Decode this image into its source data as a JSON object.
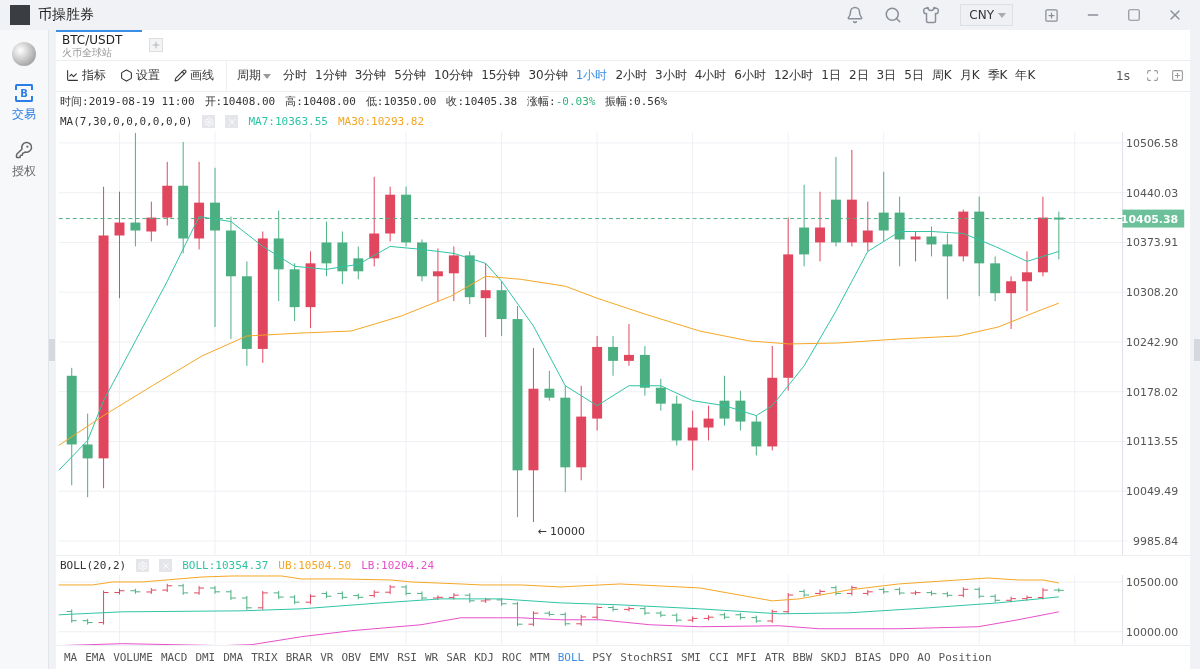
{
  "window": {
    "title": "币操胜券"
  },
  "currency": {
    "value": "CNY"
  },
  "sidebar": {
    "items": [
      {
        "kind": "trade",
        "icon_text": "B",
        "label": "交易",
        "selected": true
      },
      {
        "kind": "auth",
        "label": "授权",
        "selected": false
      }
    ]
  },
  "tabs": [
    {
      "label": "BTC/USDT",
      "sublabel": "火币全球站",
      "selected": true
    }
  ],
  "toolbar": {
    "tools": [
      {
        "kind": "indicator",
        "label": "指标"
      },
      {
        "kind": "settings",
        "label": "设置"
      },
      {
        "kind": "draw",
        "label": "画线"
      }
    ],
    "period_label": "周期",
    "periods": [
      {
        "label": "分时",
        "selected": false
      },
      {
        "label": "1分钟",
        "selected": false
      },
      {
        "label": "3分钟",
        "selected": false
      },
      {
        "label": "5分钟",
        "selected": false
      },
      {
        "label": "10分钟",
        "selected": false
      },
      {
        "label": "15分钟",
        "selected": false
      },
      {
        "label": "30分钟",
        "selected": false
      },
      {
        "label": "1小时",
        "selected": true
      },
      {
        "label": "2小时",
        "selected": false
      },
      {
        "label": "3小时",
        "selected": false
      },
      {
        "label": "4小时",
        "selected": false
      },
      {
        "label": "6小时",
        "selected": false
      },
      {
        "label": "12小时",
        "selected": false
      },
      {
        "label": "1日",
        "selected": false
      },
      {
        "label": "2日",
        "selected": false
      },
      {
        "label": "3日",
        "selected": false
      },
      {
        "label": "5日",
        "selected": false
      },
      {
        "label": "周K",
        "selected": false
      },
      {
        "label": "月K",
        "selected": false
      },
      {
        "label": "季K",
        "selected": false
      },
      {
        "label": "年K",
        "selected": false
      }
    ],
    "refresh": "1s"
  },
  "info": [
    {
      "label": "时间:",
      "value": "2019-08-19 11:00",
      "highlight": false
    },
    {
      "label": "开:",
      "value": "10408.00",
      "highlight": false
    },
    {
      "label": "高:",
      "value": "10408.00",
      "highlight": false
    },
    {
      "label": "低:",
      "value": "10350.00",
      "highlight": false
    },
    {
      "label": "收:",
      "value": "10405.38",
      "highlight": false
    },
    {
      "label": "涨幅:",
      "value": "-0.03%",
      "highlight": true
    },
    {
      "label": "振幅:",
      "value": "0.56%",
      "highlight": false
    }
  ],
  "indicator": {
    "label": "MA(7,30,0,0,0,0,0,0)",
    "values": [
      {
        "text": "MA7:10363.55",
        "color": "#2ec4a4"
      },
      {
        "text": "MA30:10293.82",
        "color": "#f5a623"
      }
    ]
  },
  "chart": {
    "price_axis": [
      "10506.58",
      "10440.03",
      "10373.91",
      "10308.20",
      "10242.90",
      "10178.02",
      "10113.55",
      "10049.49",
      "9985.84"
    ],
    "last_price": "10405.38",
    "low_marker": "← 10000"
  },
  "sub_indicator": {
    "label": "BOLL(20,2)",
    "values": [
      {
        "text": "BOLL:10354.37",
        "color": "#2ec4a4"
      },
      {
        "text": "UB:10504.50",
        "color": "#f5a623"
      },
      {
        "text": "LB:10204.24",
        "color": "#e64fc8"
      }
    ],
    "axis": [
      "10500.00",
      "10000.00"
    ]
  },
  "indicator_tabs": [
    {
      "label": "MA",
      "selected": false
    },
    {
      "label": "EMA",
      "selected": false
    },
    {
      "label": "VOLUME",
      "selected": false
    },
    {
      "label": "MACD",
      "selected": false
    },
    {
      "label": "DMI",
      "selected": false
    },
    {
      "label": "DMA",
      "selected": false
    },
    {
      "label": "TRIX",
      "selected": false
    },
    {
      "label": "BRAR",
      "selected": false
    },
    {
      "label": "VR",
      "selected": false
    },
    {
      "label": "OBV",
      "selected": false
    },
    {
      "label": "EMV",
      "selected": false
    },
    {
      "label": "RSI",
      "selected": false
    },
    {
      "label": "WR",
      "selected": false
    },
    {
      "label": "SAR",
      "selected": false
    },
    {
      "label": "KDJ",
      "selected": false
    },
    {
      "label": "ROC",
      "selected": false
    },
    {
      "label": "MTM",
      "selected": false
    },
    {
      "label": "BOLL",
      "selected": true
    },
    {
      "label": "PSY",
      "selected": false
    },
    {
      "label": "StochRSI",
      "selected": false
    },
    {
      "label": "SMI",
      "selected": false
    },
    {
      "label": "CCI",
      "selected": false
    },
    {
      "label": "MFI",
      "selected": false
    },
    {
      "label": "ATR",
      "selected": false
    },
    {
      "label": "BBW",
      "selected": false
    },
    {
      "label": "SKDJ",
      "selected": false
    },
    {
      "label": "BIAS",
      "selected": false
    },
    {
      "label": "DPO",
      "selected": false
    },
    {
      "label": "AO",
      "selected": false
    },
    {
      "label": "Position",
      "selected": false
    }
  ]
}
